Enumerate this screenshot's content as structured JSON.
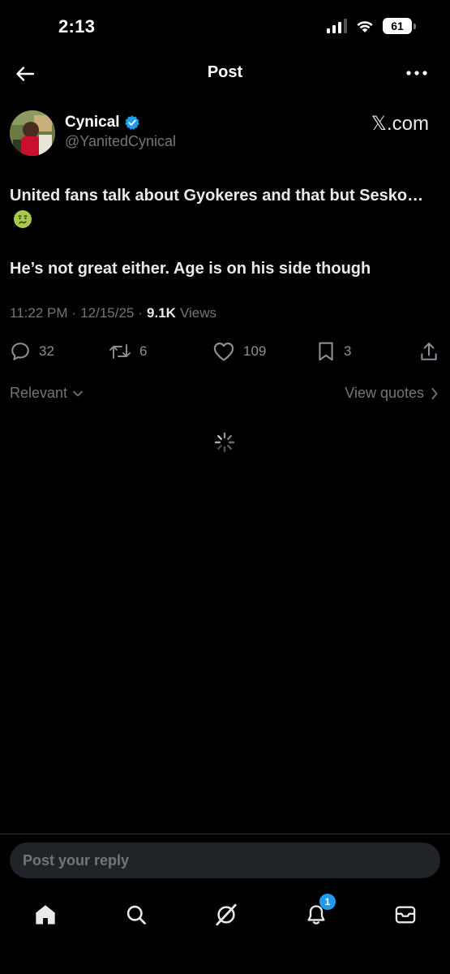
{
  "status_bar": {
    "time": "2:13",
    "battery": "61"
  },
  "header": {
    "title": "Post"
  },
  "author": {
    "name": "Cynical",
    "handle": "@YanitedCynical",
    "verified": true,
    "source_link": "𝕏.com"
  },
  "post": {
    "line1": "United fans talk about Gyokeres and that but Sesko…",
    "line2": "He’s not great either. Age is on his side though",
    "emoji": "nauseated-face",
    "time": "11:22 PM",
    "date": "12/15/25",
    "views_count": "9.1K",
    "views_label": "Views",
    "separator": "·"
  },
  "actions": {
    "replies": "32",
    "reposts": "6",
    "likes": "109",
    "bookmarks": "3"
  },
  "filters": {
    "sort_label": "Relevant",
    "view_quotes_label": "View quotes"
  },
  "reply": {
    "placeholder": "Post your reply"
  },
  "tab_bar": {
    "notification_count": "1"
  },
  "colors": {
    "background": "#000000",
    "text_primary": "#e7e9ea",
    "text_secondary": "#71767b",
    "accent": "#1d9bf0",
    "input_bg": "#202327"
  }
}
